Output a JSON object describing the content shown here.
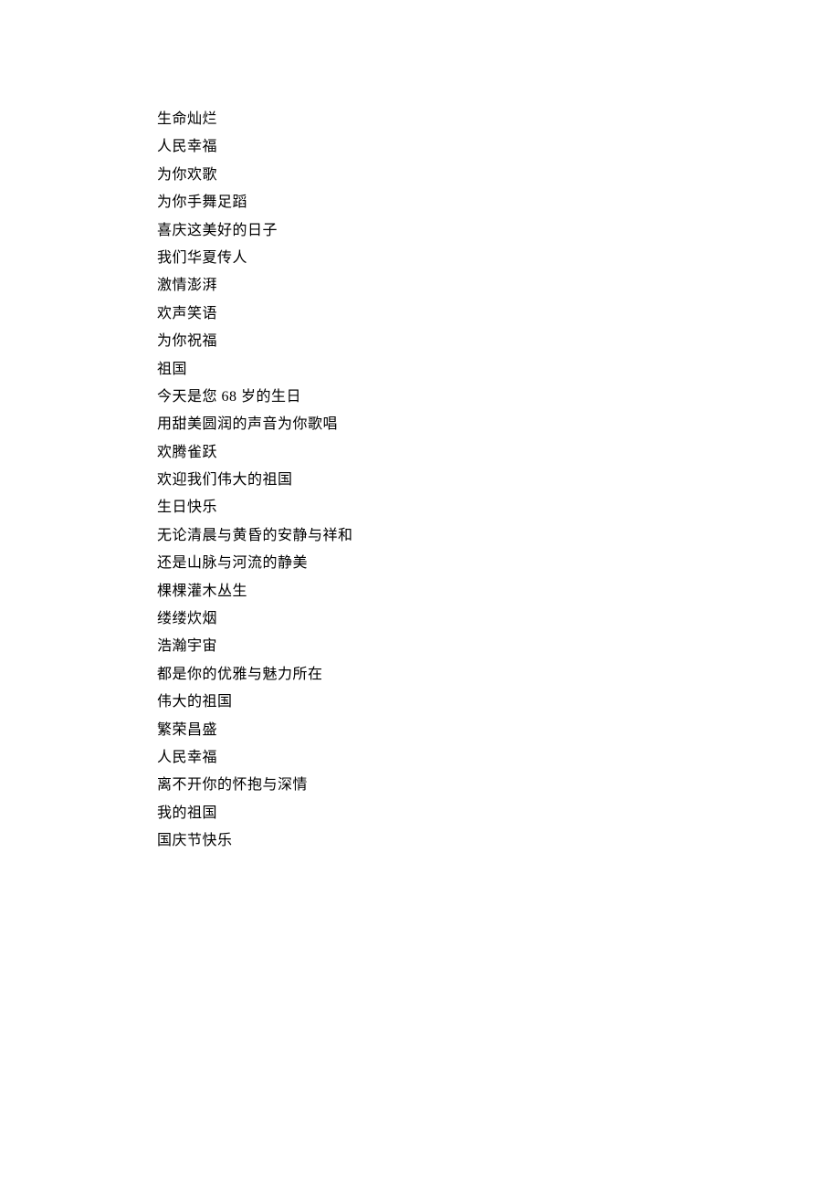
{
  "poem": {
    "lines": [
      "生命灿烂",
      "人民幸福",
      "为你欢歌",
      "为你手舞足蹈",
      "喜庆这美好的日子",
      "我们华夏传人",
      "激情澎湃",
      "欢声笑语",
      "为你祝福",
      "祖国",
      "今天是您 68 岁的生日",
      "用甜美圆润的声音为你歌唱",
      "欢腾雀跃",
      "欢迎我们伟大的祖国",
      "生日快乐",
      "无论清晨与黄昏的安静与祥和",
      "还是山脉与河流的静美",
      "棵棵灌木丛生",
      "缕缕炊烟",
      "浩瀚宇宙",
      "都是你的优雅与魅力所在",
      "伟大的祖国",
      "繁荣昌盛",
      "人民幸福",
      "离不开你的怀抱与深情",
      "我的祖国",
      "国庆节快乐"
    ]
  }
}
